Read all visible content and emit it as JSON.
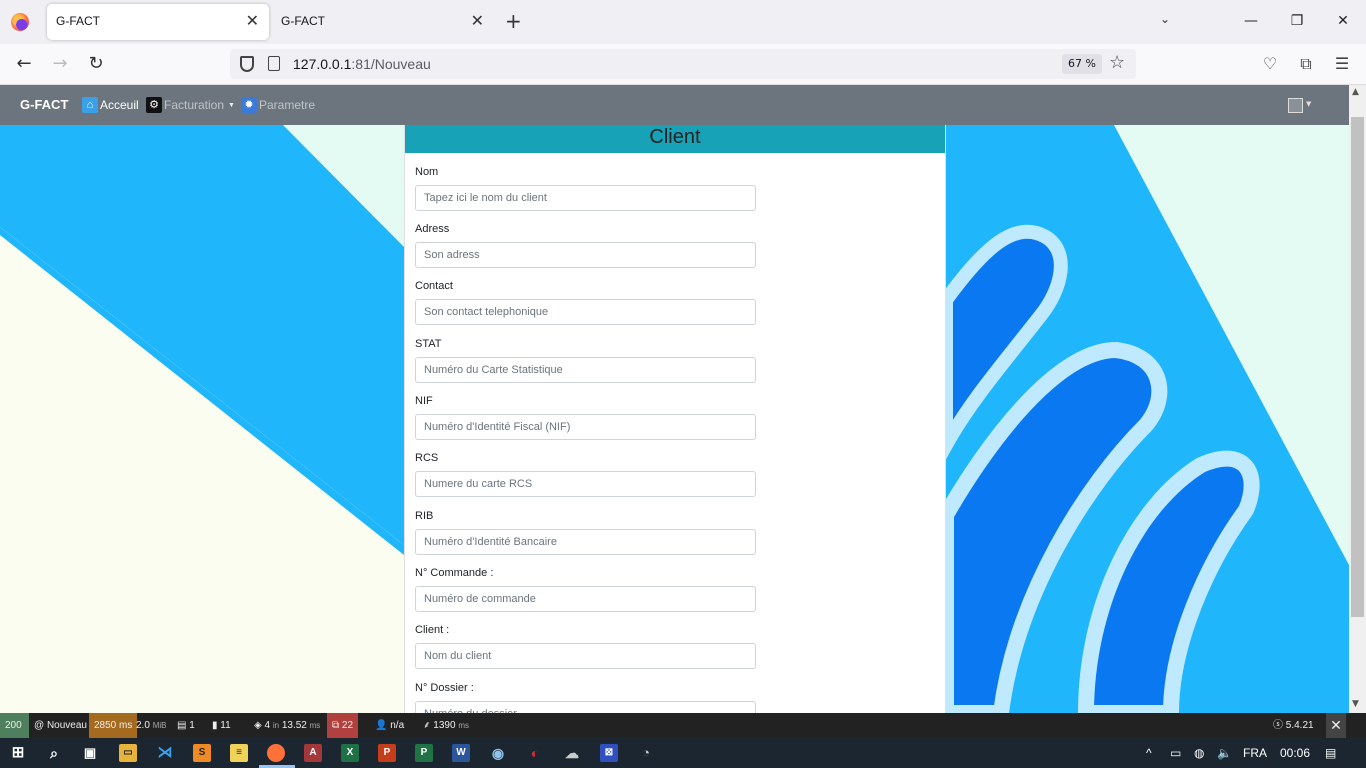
{
  "browser": {
    "tabs": [
      {
        "title": "G-FACT",
        "active": true
      },
      {
        "title": "G-FACT",
        "active": false
      }
    ],
    "url_host": "127.0.0.1",
    "url_rest": ":81/Nouveau",
    "zoom": "67 %"
  },
  "app": {
    "brand": "G-FACT",
    "menu": {
      "home": "Acceuil",
      "billing": "Facturation",
      "settings": "Parametre"
    }
  },
  "form": {
    "title": "Client",
    "fields": [
      {
        "label": "Nom",
        "placeholder": "Tapez ici le nom du client"
      },
      {
        "label": "Adress",
        "placeholder": "Son adress"
      },
      {
        "label": "Contact",
        "placeholder": "Son contact telephonique"
      },
      {
        "label": "STAT",
        "placeholder": "Numéro du Carte Statistique"
      },
      {
        "label": "NIF",
        "placeholder": "Numéro d'Identité Fiscal (NIF)"
      },
      {
        "label": "RCS",
        "placeholder": "Numere du carte RCS"
      },
      {
        "label": "RIB",
        "placeholder": "Numéro d'Identité Bancaire"
      },
      {
        "label": "N° Commande :",
        "placeholder": "Numéro de commande"
      },
      {
        "label": "Client :",
        "placeholder": "Nom du client"
      },
      {
        "label": "N° Dossier :",
        "placeholder": "Numéro du dossier"
      }
    ]
  },
  "debugbar": {
    "status": "200",
    "route": "Nouveau",
    "time": "2850 ms",
    "memory": "2.0",
    "memory_unit": "MiB",
    "forms": "1",
    "validator": "11",
    "cache_count": "4",
    "cache_time_prefix": "in",
    "cache_time": "13.52",
    "cache_time_unit": "ms",
    "translations": "22",
    "user": "n/a",
    "twig_time": "1390",
    "twig_time_unit": "ms",
    "symfony_version": "5.4.21"
  },
  "taskbar": {
    "language": "FRA",
    "clock": "00:06"
  },
  "colors": {
    "app_navbar": "#6c757d",
    "card_header": "#17a2b8",
    "bg_blue": "#1fb6fb",
    "bg_deep_blue": "#0a78f0"
  }
}
